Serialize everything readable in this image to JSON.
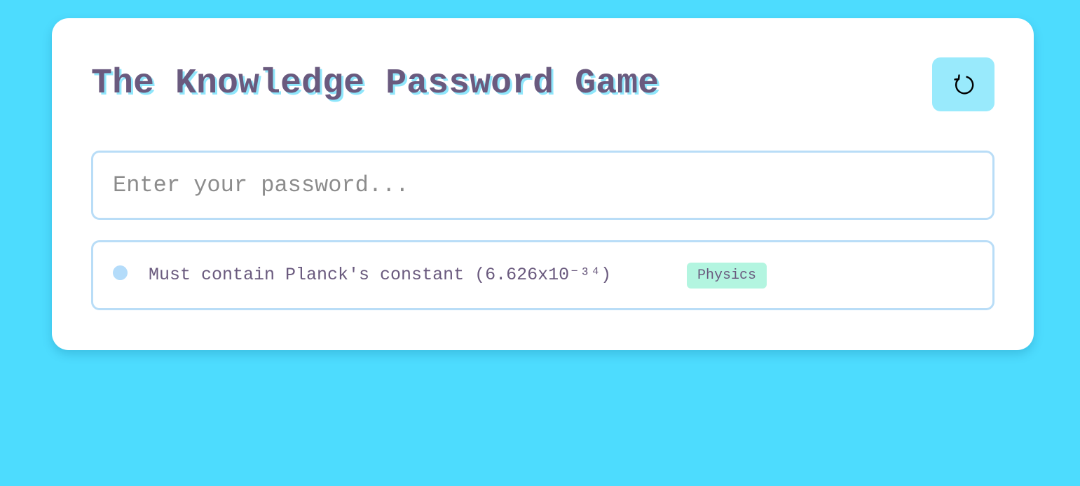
{
  "game": {
    "title": "The Knowledge Password Game",
    "reset_icon": "refresh-icon",
    "password": {
      "value": "",
      "placeholder": "Enter your password..."
    },
    "rules": [
      {
        "text": "Must contain Planck's constant (6.626x10⁻³⁴)",
        "category": "Physics",
        "status_icon": "status-dot-icon",
        "status_color": "#b4dcfa",
        "category_color": "#b3f5e0"
      }
    ]
  },
  "colors": {
    "background": "#4ddcfe",
    "card": "#ffffff",
    "title": "#6a5a7e",
    "title_shadow": "#8fe6fb",
    "reset_button": "#99eafc",
    "input_border": "#b9ddf7"
  }
}
